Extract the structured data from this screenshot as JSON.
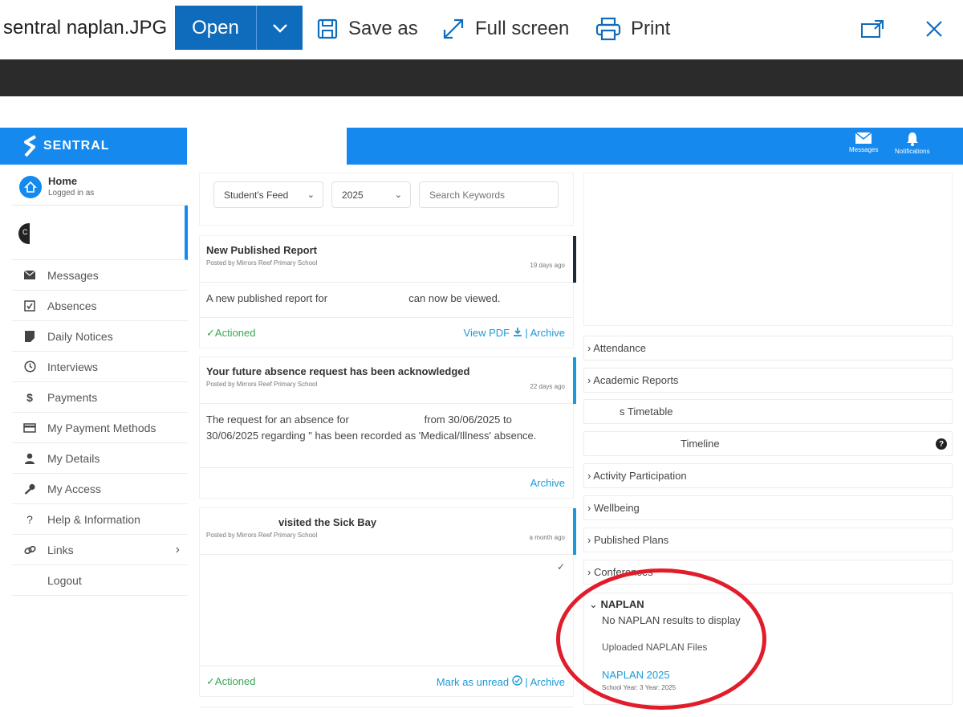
{
  "viewer": {
    "filename": "sentral naplan.JPG",
    "open_label": "Open",
    "save_as_label": "Save as",
    "full_screen_label": "Full screen",
    "print_label": "Print"
  },
  "sentral": {
    "logo_text": "SENTRAL",
    "header": {
      "messages_label": "Messages",
      "notifications_label": "Notifications"
    }
  },
  "sidebar": {
    "home_title": "Home",
    "home_sub": "Logged in as",
    "student_initial": "C",
    "items": [
      {
        "label": "Messages",
        "icon": "envelope-icon"
      },
      {
        "label": "Absences",
        "icon": "checkbox-icon"
      },
      {
        "label": "Daily Notices",
        "icon": "notice-icon"
      },
      {
        "label": "Interviews",
        "icon": "clock-icon"
      },
      {
        "label": "Payments",
        "icon": "dollar-icon"
      },
      {
        "label": "My Payment Methods",
        "icon": "card-icon"
      },
      {
        "label": "My Details",
        "icon": "person-icon"
      },
      {
        "label": "My Access",
        "icon": "key-icon"
      },
      {
        "label": "Help & Information",
        "icon": "question-icon"
      },
      {
        "label": "Links",
        "icon": "link-icon"
      },
      {
        "label": "Logout",
        "icon": ""
      }
    ]
  },
  "feed": {
    "filter_selected": "Student's Feed",
    "year_selected": "2025",
    "search_placeholder": "Search Keywords",
    "cards": [
      {
        "title": "New Published Report",
        "posted": "Posted by Mirrors Reef Primary School",
        "ago": "19 days ago",
        "body_start": "A new published report for",
        "body_end": "can now be viewed.",
        "actioned": "✓Actioned",
        "view_pdf": "View PDF",
        "separator": "|",
        "archive": "Archive"
      },
      {
        "title": "Your future absence request has been acknowledged",
        "posted": "Posted by Mirrors Reef Primary School",
        "ago": "22 days ago",
        "body": "The request for an absence for                          from 30/06/2025 to 30/06/2025 regarding \" has been recorded as 'Medical/Illness' absence.",
        "archive": "Archive"
      },
      {
        "title": "visited the Sick Bay",
        "posted": "Posted by Mirrors Reef Primary School",
        "ago": "a month ago",
        "actioned": "✓Actioned",
        "mark_unread": "Mark as unread",
        "separator": "|",
        "archive": "Archive"
      }
    ]
  },
  "right": {
    "rows": [
      "› Attendance",
      "› Academic Reports",
      "s Timetable",
      "Timeline",
      "› Activity Participation",
      "› Wellbeing",
      "› Published Plans",
      "› Conferences"
    ],
    "naplan": {
      "title": "NAPLAN",
      "none": "No NAPLAN results to display",
      "files_heading": "Uploaded NAPLAN Files",
      "file_link": "NAPLAN 2025",
      "file_meta": "School Year: 3  Year: 2025"
    }
  },
  "colors": {
    "viewer_accent": "#0f6cbd",
    "sentral_blue": "#1589ee",
    "link_blue": "#1a9bd7",
    "actioned_green": "#3aa655",
    "highlight_red": "#e11d2b"
  }
}
